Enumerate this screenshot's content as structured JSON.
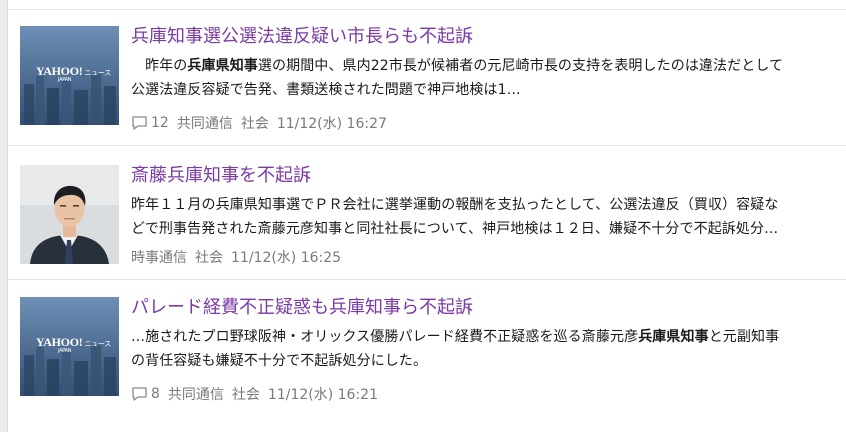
{
  "articles": [
    {
      "title": "兵庫知事選公選法違反疑い市長らも不起訴",
      "snippet_lines": [
        [
          "　昨年の",
          "兵庫県知事",
          "選の期間中、県内22市長が候補者の元尼崎市長の支持を表明したのは違法だとして"
        ],
        [
          "公選法違反容疑で告発、書類送検された問題で神戸地検は1…",
          "",
          ""
        ]
      ],
      "comment_count": "12",
      "source": "共同通信",
      "category": "社会",
      "datetime": "11/12(水) 16:27",
      "thumb": "yahoo-news-logo"
    },
    {
      "title": "斎藤兵庫知事を不起訴",
      "snippet_lines": [
        [
          "昨年１１月の兵庫県知事選でＰＲ会社に選挙運動の報酬を支払ったとして、公選法違反（買収）容疑な",
          "",
          ""
        ],
        [
          "どで刑事告発された斎藤元彦知事と同社社長について、神戸地検は１２日、嫌疑不十分で不起訴処分…",
          "",
          ""
        ]
      ],
      "comment_count": "",
      "source": "時事通信",
      "category": "社会",
      "datetime": "11/12(水) 16:25",
      "thumb": "person-portrait"
    },
    {
      "title": "パレード経費不正疑惑も兵庫知事ら不起訴",
      "snippet_lines": [
        [
          "…施されたプロ野球阪神・オリックス優勝パレード経費不正疑惑を巡る斎藤元彦",
          "兵庫県知事",
          "と元副知事"
        ],
        [
          "の背任容疑も嫌疑不十分で不起訴処分にした。",
          "",
          ""
        ]
      ],
      "comment_count": "8",
      "source": "共同通信",
      "category": "社会",
      "datetime": "11/12(水) 16:21",
      "thumb": "yahoo-news-logo"
    }
  ],
  "logo": {
    "brand": "YAHOO!",
    "product": "ニュース",
    "region": "JAPAN"
  },
  "colors": {
    "title": "#7b3aa5",
    "meta": "#7a7a7a",
    "text": "#1a1a1a",
    "highlight_bold": true
  }
}
